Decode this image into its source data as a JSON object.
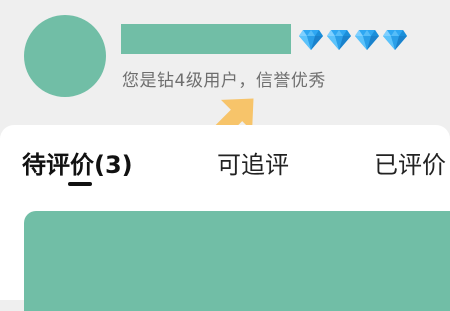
{
  "profile": {
    "level_text": "您是钻4级用户，信誉优秀",
    "diamond_count": 4,
    "diamond_icon": "diamond-icon"
  },
  "tabs": [
    {
      "label": "待评价(3)",
      "active": true
    },
    {
      "label": "可追评",
      "active": false
    },
    {
      "label": "已评价",
      "active": false
    }
  ],
  "colors": {
    "placeholder": "#71bea6",
    "diamond": "#2ea7f2",
    "arrow": "#f7c46a",
    "background": "#efefef"
  }
}
